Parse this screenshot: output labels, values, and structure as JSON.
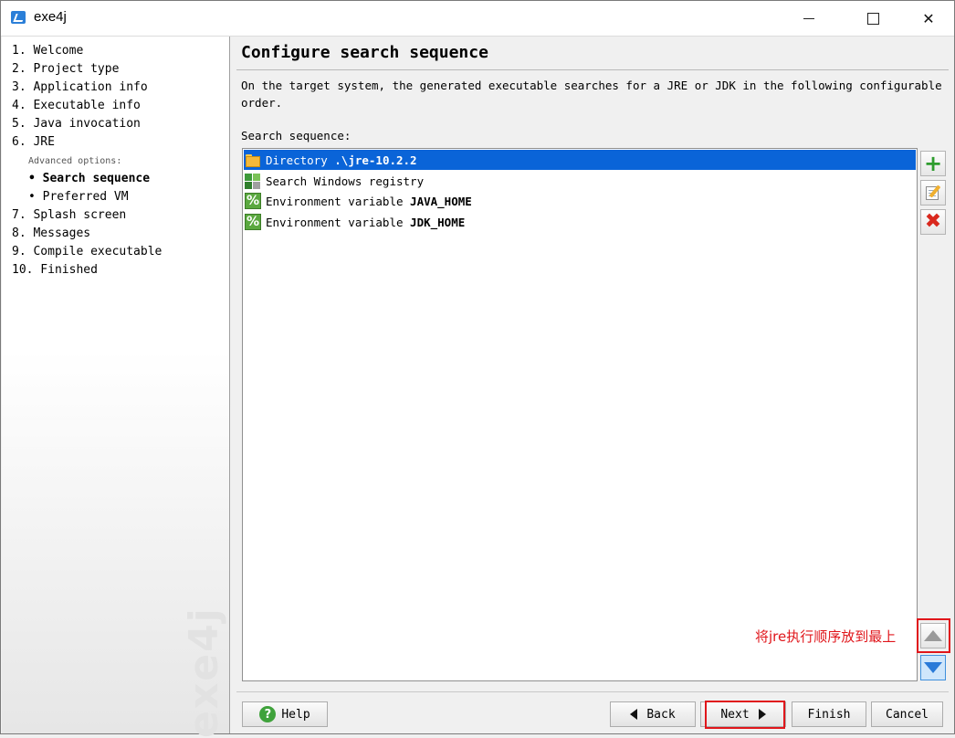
{
  "window": {
    "title": "exe4j",
    "controls": {
      "minimize": "minimize",
      "maximize": "maximize",
      "close": "✕"
    }
  },
  "sidebar": {
    "steps": [
      {
        "label": "1. Welcome"
      },
      {
        "label": "2. Project type"
      },
      {
        "label": "3. Application info"
      },
      {
        "label": "4. Executable info"
      },
      {
        "label": "5. Java invocation"
      },
      {
        "label": "6. JRE"
      }
    ],
    "advanced_label": "Advanced options:",
    "sub_steps": [
      {
        "label": "• Search sequence",
        "active": true
      },
      {
        "label": "• Preferred VM",
        "active": false
      }
    ],
    "steps_after": [
      {
        "label": "7. Splash screen"
      },
      {
        "label": "8. Messages"
      },
      {
        "label": "9. Compile executable"
      },
      {
        "label": "10. Finished"
      }
    ],
    "watermark": "exe4j"
  },
  "main": {
    "heading": "Configure search sequence",
    "description": "On the target system, the generated executable searches for a JRE or JDK in the following configurable order.",
    "list_label": "Search sequence:",
    "entries": [
      {
        "prefix": "Directory ",
        "value": ".\\jre-10.2.2",
        "icon": "folder-icon",
        "selected": true
      },
      {
        "prefix": "Search Windows registry",
        "value": "",
        "icon": "registry-icon",
        "selected": false
      },
      {
        "prefix": "Environment variable ",
        "value": "JAVA_HOME",
        "icon": "percent-icon",
        "selected": false
      },
      {
        "prefix": "Environment variable ",
        "value": "JDK_HOME",
        "icon": "percent-icon",
        "selected": false
      }
    ]
  },
  "side_toolbar": {
    "add": "+",
    "remove": "✖"
  },
  "annotation": {
    "text": "将jre执行顺序放到最上",
    "color": "#e0161b"
  },
  "buttons": {
    "help": "Help",
    "help_glyph": "?",
    "back": "Back",
    "next": "Next",
    "finish": "Finish",
    "cancel": "Cancel"
  },
  "colors": {
    "selection": "#0a64d8",
    "accent_green": "#2e9c2e",
    "delete_red": "#d9281d"
  }
}
